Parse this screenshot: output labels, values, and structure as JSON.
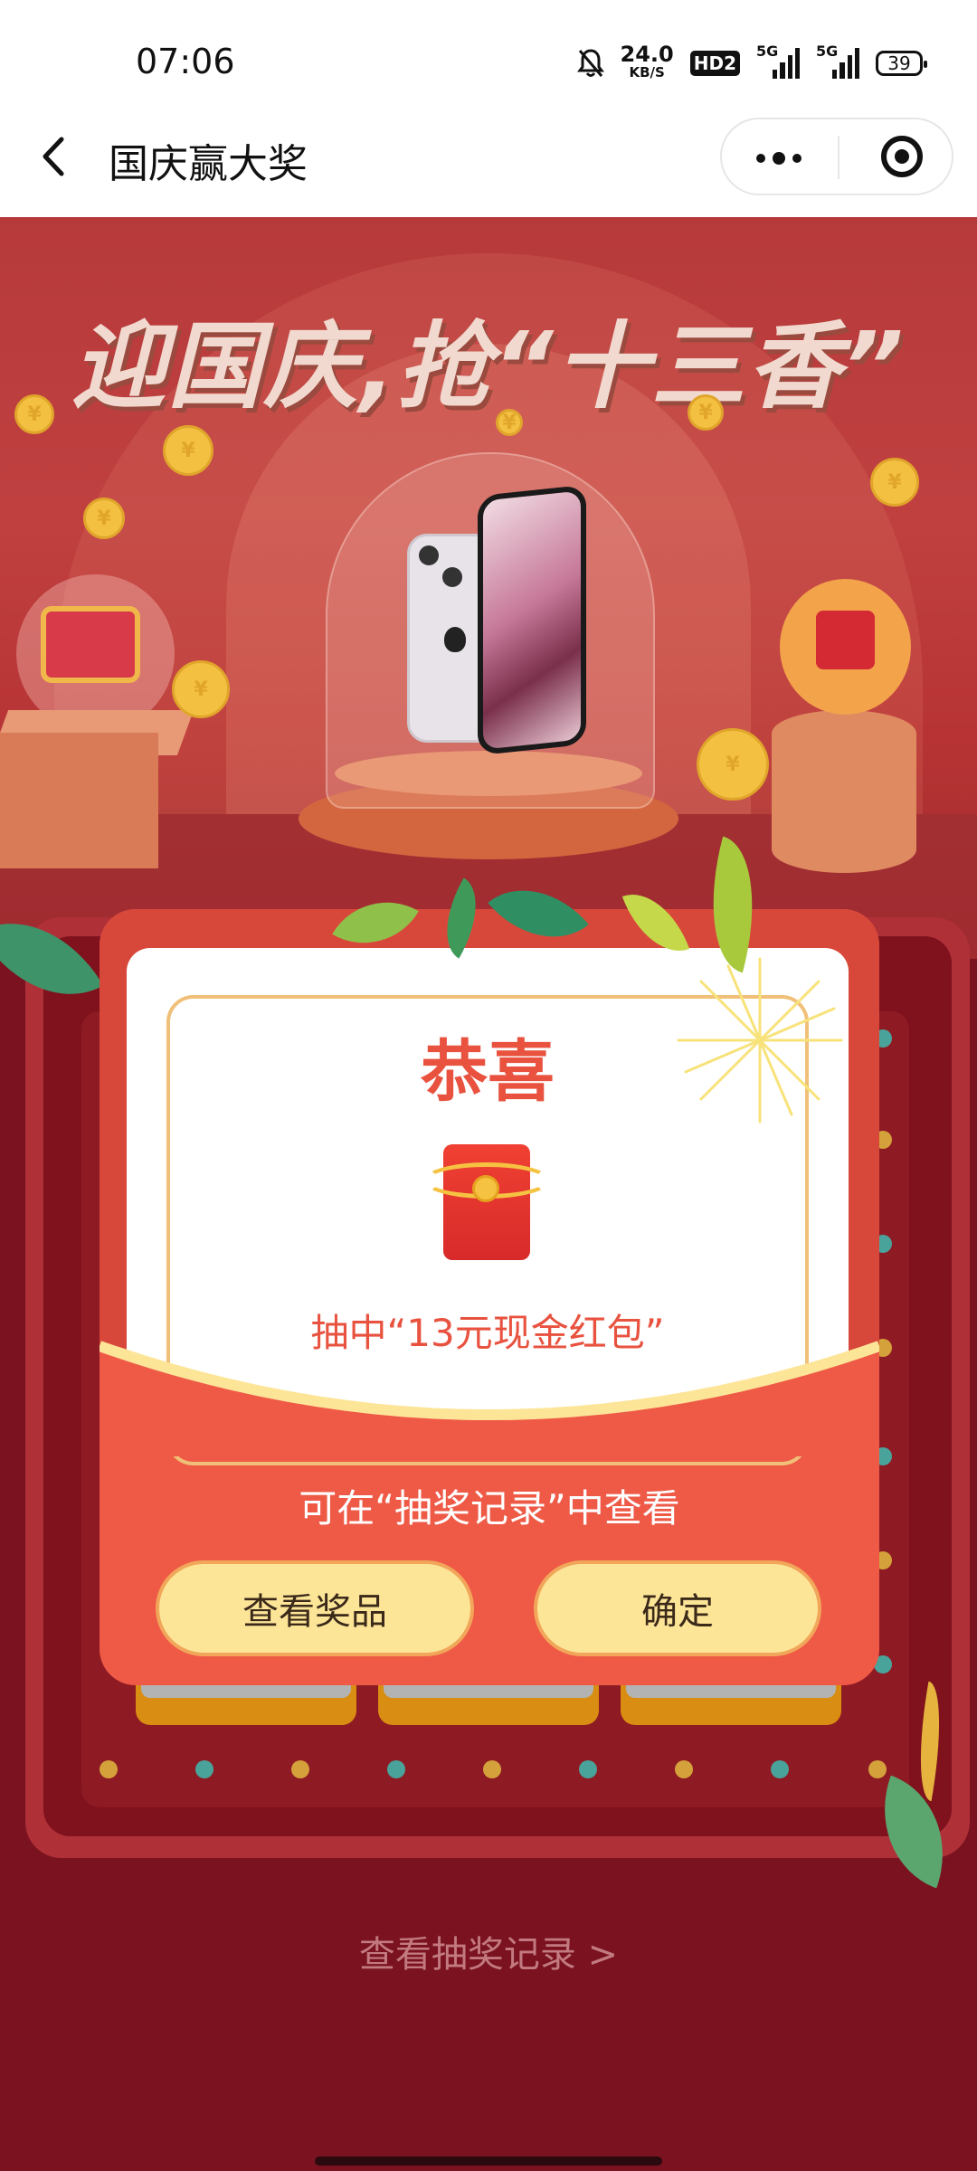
{
  "status_bar": {
    "time": "07:06",
    "speed_value": "24.0",
    "speed_unit": "KB/S",
    "hd_badge": "HD2",
    "sim1_label": "5G",
    "sim2_label": "5G",
    "battery": "39",
    "icons": [
      "bell-off-icon",
      "signal-icon",
      "battery-icon"
    ]
  },
  "nav": {
    "title": "国庆赢大奖",
    "back_icon": "chevron-left-icon",
    "more_icon": "more-dots-icon",
    "close_icon": "target-icon"
  },
  "banner": {
    "headline": "迎国庆,抢“十三香”"
  },
  "modal": {
    "title": "恭喜",
    "prize_text": "抽中“13元现金红包”",
    "hint": "可在“抽奖记录”中查看",
    "view_button": "查看奖品",
    "confirm_button": "确定",
    "prize_icon": "red-envelope-icon"
  },
  "footer": {
    "records_link": "查看抽奖记录 >"
  },
  "colors": {
    "accent_red": "#e8523f",
    "button_yellow": "#fde598",
    "page_bg": "#7a1220"
  }
}
